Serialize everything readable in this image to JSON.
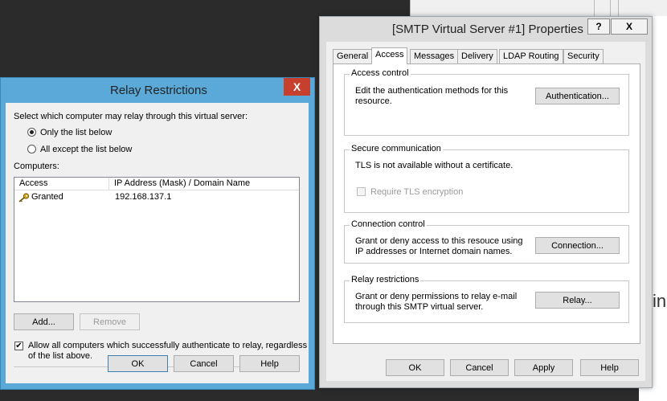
{
  "smtp_window": {
    "title": "[SMTP Virtual Server #1] Properties",
    "help_button": "?",
    "close_button": "X",
    "tabs": [
      "General",
      "Access",
      "Messages",
      "Delivery",
      "LDAP Routing",
      "Security"
    ],
    "active_tab": "Access",
    "access_control": {
      "label": "Access control",
      "text_line1": "Edit the authentication methods for this",
      "text_line2": "resource.",
      "button": "Authentication..."
    },
    "secure_communication": {
      "label": "Secure communication",
      "text": "TLS is not available without a certificate.",
      "checkbox_label": "Require TLS encryption"
    },
    "connection_control": {
      "label": "Connection control",
      "text_line1": "Grant or deny access to this resouce using",
      "text_line2": "IP addresses or Internet domain names.",
      "button": "Connection..."
    },
    "relay_restrictions": {
      "label": "Relay restrictions",
      "text_line1": "Grant or deny permissions to relay e-mail",
      "text_line2": "through this SMTP virtual server.",
      "button": "Relay..."
    },
    "footer": {
      "ok": "OK",
      "cancel": "Cancel",
      "apply": "Apply",
      "help": "Help"
    }
  },
  "relay_dialog": {
    "title": "Relay Restrictions",
    "close_button": "X",
    "prompt": "Select which computer may relay through this virtual server:",
    "radio_only": "Only the list below",
    "radio_except": "All except the list below",
    "selected_radio": "Only the list below",
    "computers_label": "Computers:",
    "columns": [
      "Access",
      "IP Address (Mask) / Domain Name"
    ],
    "rows": [
      {
        "access": "Granted",
        "address": "192.168.137.1"
      }
    ],
    "add_button": "Add...",
    "remove_button": "Remove",
    "allow_auth_line1": "Allow all computers which successfully authenticate to relay, regardless",
    "allow_auth_line2": "of the list above.",
    "allow_auth_checked": true,
    "footer": {
      "ok": "OK",
      "cancel": "Cancel",
      "help": "Help"
    }
  },
  "background": {
    "partial_text": "in"
  },
  "colors": {
    "dialog_accent": "#5aa9d8",
    "close_red": "#c7402e",
    "key_icon": "#d4a017"
  }
}
